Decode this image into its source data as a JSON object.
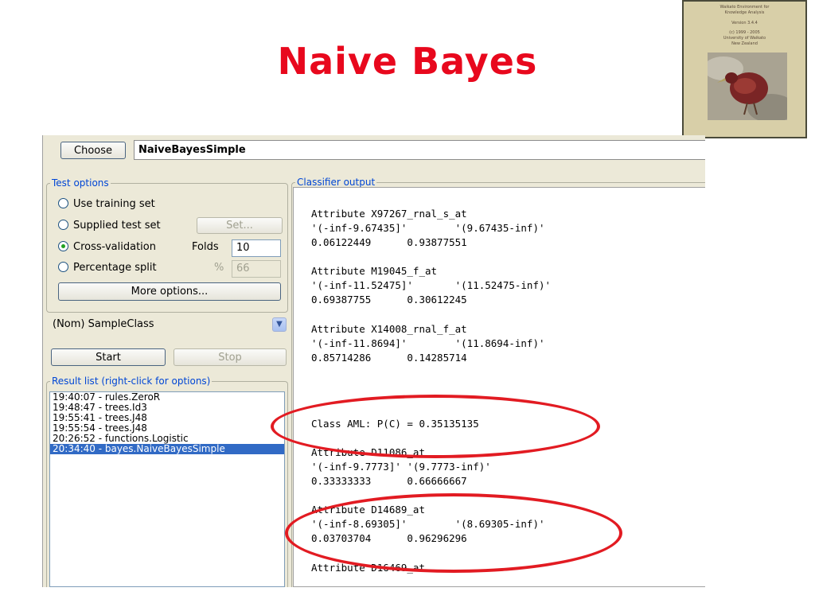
{
  "slide": {
    "title": "Naive Bayes"
  },
  "book_cover": {
    "lines": [
      "Waikato Environment for",
      "Knowledge Analysis",
      "Version 3.4.4",
      "(c) 1999 - 2005",
      "University of Waikato",
      "New Zealand"
    ]
  },
  "chooser": {
    "button_label": "Choose",
    "scheme": "NaiveBayesSimple"
  },
  "test_options": {
    "legend": "Test options",
    "options": [
      "Use training set",
      "Supplied test set",
      "Cross-validation",
      "Percentage split"
    ],
    "selected": "Cross-validation",
    "set_button": "Set...",
    "folds_label": "Folds",
    "folds_value": "10",
    "percent_symbol": "%",
    "percent_value": "66",
    "more_options": "More options..."
  },
  "class_selector": {
    "value": "(Nom) SampleClass"
  },
  "actions": {
    "start": "Start",
    "stop": "Stop"
  },
  "result_list": {
    "legend": "Result list (right-click for options)",
    "items": [
      "19:40:07 - rules.ZeroR",
      "19:48:47 - trees.Id3",
      "19:55:41 - trees.J48",
      "19:55:54 - trees.J48",
      "20:26:52 - functions.Logistic",
      "20:34:40 - bayes.NaiveBayesSimple"
    ],
    "selected_index": 5
  },
  "classifier_output": {
    "legend": "Classifier output",
    "lines": [
      "Attribute X97267_rnal_s_at",
      "'(-inf-9.67435]'        '(9.67435-inf)'",
      "0.06122449      0.93877551",
      "Attribute M19045_f_at",
      "'(-inf-11.52475]'       '(11.52475-inf)'",
      "0.69387755      0.30612245",
      "Attribute X14008_rnal_f_at",
      "'(-inf-11.8694]'        '(11.8694-inf)'",
      "0.85714286      0.14285714",
      "Class AML: P(C) = 0.35135135",
      "Attribute D11086_at",
      "'(-inf-9.7773]' '(9.7773-inf)'",
      "0.33333333      0.66666667",
      "Attribute D14689_at",
      "'(-inf-8.69305]'        '(8.69305-inf)'",
      "0.03703704      0.96296296",
      "Attribute D16469_at"
    ]
  },
  "annotation_color": "#e21b22",
  "title_color": "#e8081d"
}
